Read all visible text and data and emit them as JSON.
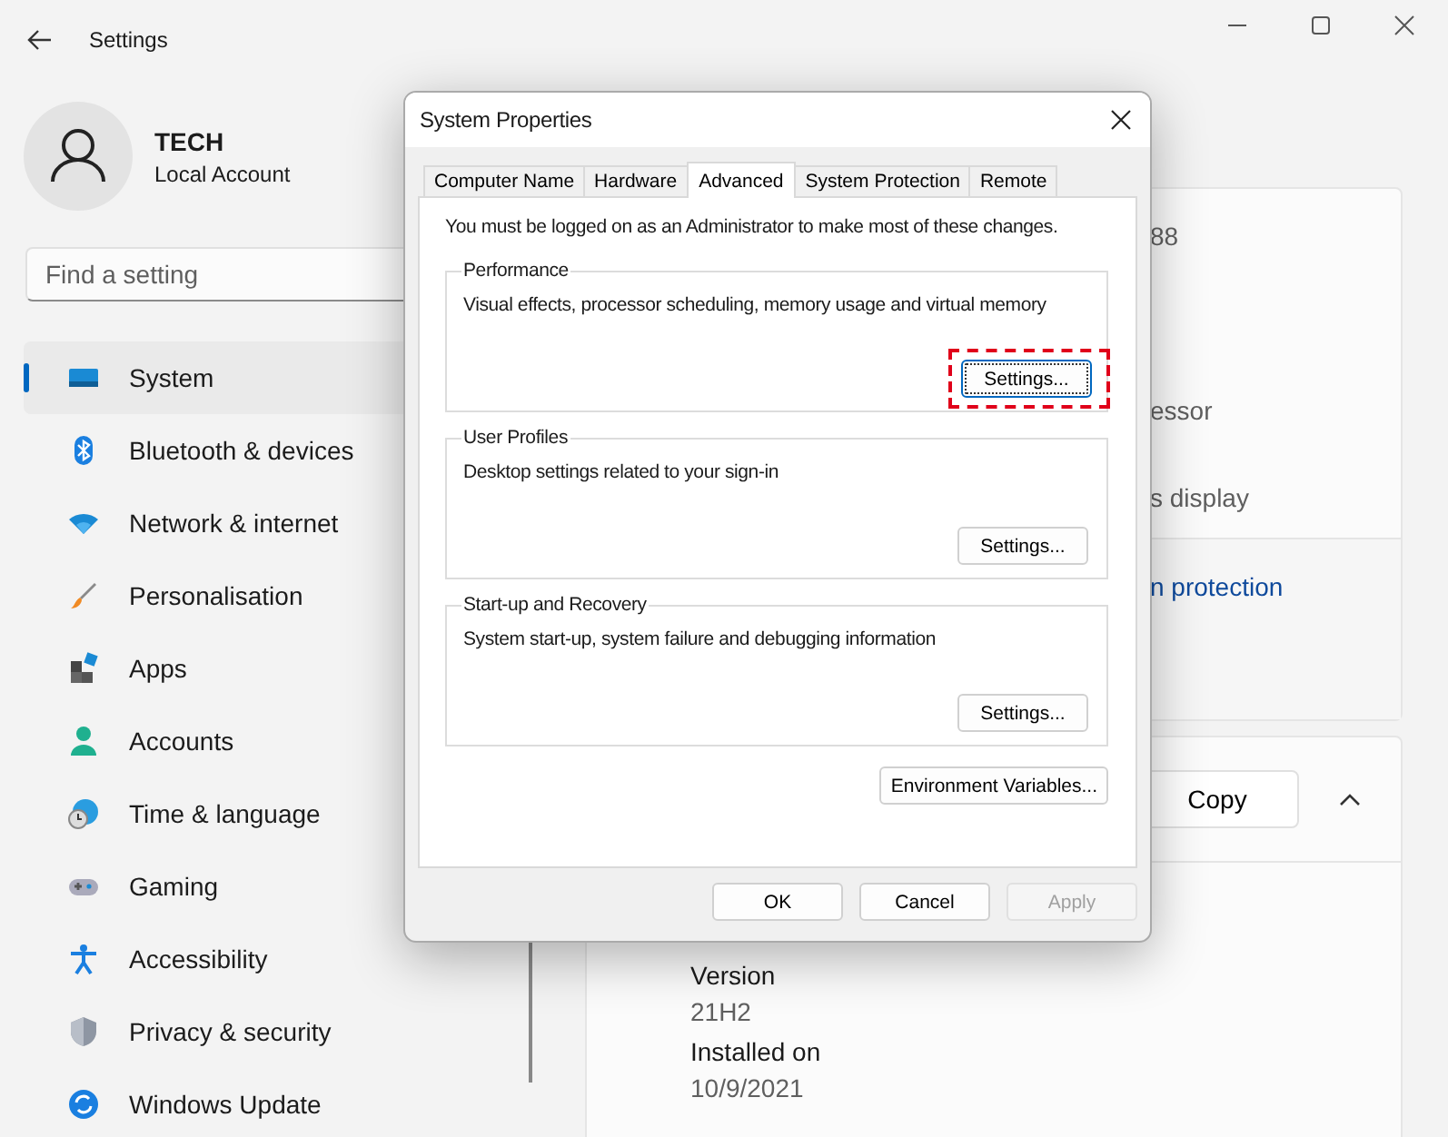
{
  "window": {
    "title": "Settings"
  },
  "account": {
    "name": "TECH",
    "type": "Local Account"
  },
  "search": {
    "placeholder": "Find a setting"
  },
  "sidebar": {
    "items": [
      {
        "label": "System",
        "selected": true
      },
      {
        "label": "Bluetooth & devices",
        "selected": false
      },
      {
        "label": "Network & internet",
        "selected": false
      },
      {
        "label": "Personalisation",
        "selected": false
      },
      {
        "label": "Apps",
        "selected": false
      },
      {
        "label": "Accounts",
        "selected": false
      },
      {
        "label": "Time & language",
        "selected": false
      },
      {
        "label": "Gaming",
        "selected": false
      },
      {
        "label": "Accessibility",
        "selected": false
      },
      {
        "label": "Privacy & security",
        "selected": false
      },
      {
        "label": "Windows Update",
        "selected": false
      }
    ]
  },
  "device_card": {
    "fragments": [
      "88",
      "essor",
      "s display"
    ],
    "link": "n protection"
  },
  "windows_card": {
    "copy_button": "Copy",
    "expanded": true,
    "specs": [
      {
        "label": "Version",
        "value": "21H2"
      },
      {
        "label": "Installed on",
        "value": "10/9/2021"
      }
    ]
  },
  "dialog": {
    "title": "System Properties",
    "tabs": [
      {
        "label": "Computer Name",
        "selected": false
      },
      {
        "label": "Hardware",
        "selected": false
      },
      {
        "label": "Advanced",
        "selected": true
      },
      {
        "label": "System Protection",
        "selected": false
      },
      {
        "label": "Remote",
        "selected": false
      }
    ],
    "notice": "You must be logged on as an Administrator to make most of these changes.",
    "groups": [
      {
        "title": "Performance",
        "description": "Visual effects, processor scheduling, memory usage and virtual memory",
        "button": "Settings...",
        "highlighted": true
      },
      {
        "title": "User Profiles",
        "description": "Desktop settings related to your sign-in",
        "button": "Settings...",
        "highlighted": false
      },
      {
        "title": "Start-up and Recovery",
        "description": "System start-up, system failure and debugging information",
        "button": "Settings...",
        "highlighted": false
      }
    ],
    "env_button": "Environment Variables...",
    "buttons": [
      {
        "label": "OK",
        "disabled": false
      },
      {
        "label": "Cancel",
        "disabled": false
      },
      {
        "label": "Apply",
        "disabled": true
      }
    ]
  }
}
